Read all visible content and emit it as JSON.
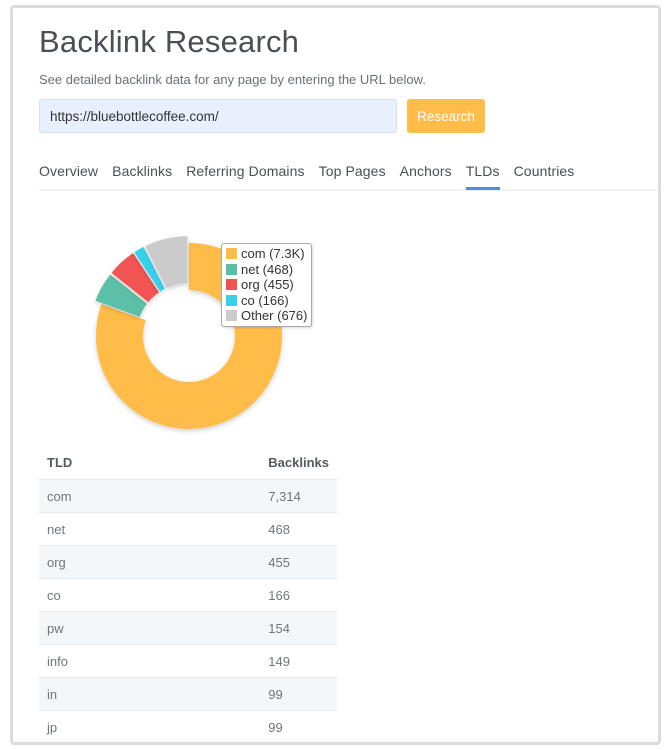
{
  "header": {
    "title": "Backlink Research",
    "subtitle": "See detailed backlink data for any page by entering the URL below."
  },
  "search": {
    "value": "https://bluebottlecoffee.com/",
    "button_label": "Research"
  },
  "tabs": [
    {
      "label": "Overview",
      "active": false
    },
    {
      "label": "Backlinks",
      "active": false
    },
    {
      "label": "Referring Domains",
      "active": false
    },
    {
      "label": "Top Pages",
      "active": false
    },
    {
      "label": "Anchors",
      "active": false
    },
    {
      "label": "TLDs",
      "active": true
    },
    {
      "label": "Countries",
      "active": false
    }
  ],
  "colors": {
    "accent": "#ffbc48",
    "tab_active": "#4a90e2",
    "input_bg": "#e8f0fd"
  },
  "chart_data": {
    "type": "pie",
    "donut": true,
    "title": "",
    "legend_position": "right-top",
    "slices": [
      {
        "label": "com",
        "value": 7314,
        "legend": "com (7.3K)",
        "color": "#ffbc48"
      },
      {
        "label": "net",
        "value": 468,
        "legend": "net (468)",
        "color": "#5bbfa8"
      },
      {
        "label": "org",
        "value": 455,
        "legend": "org (455)",
        "color": "#f25252"
      },
      {
        "label": "co",
        "value": 166,
        "legend": "co (166)",
        "color": "#36d1ea"
      },
      {
        "label": "Other",
        "value": 676,
        "legend": "Other (676)",
        "color": "#cbcbcb"
      }
    ]
  },
  "table": {
    "headers": [
      "TLD",
      "Backlinks"
    ],
    "rows": [
      [
        "com",
        "7,314"
      ],
      [
        "net",
        "468"
      ],
      [
        "org",
        "455"
      ],
      [
        "co",
        "166"
      ],
      [
        "pw",
        "154"
      ],
      [
        "info",
        "149"
      ],
      [
        "in",
        "99"
      ],
      [
        "jp",
        "99"
      ]
    ]
  }
}
